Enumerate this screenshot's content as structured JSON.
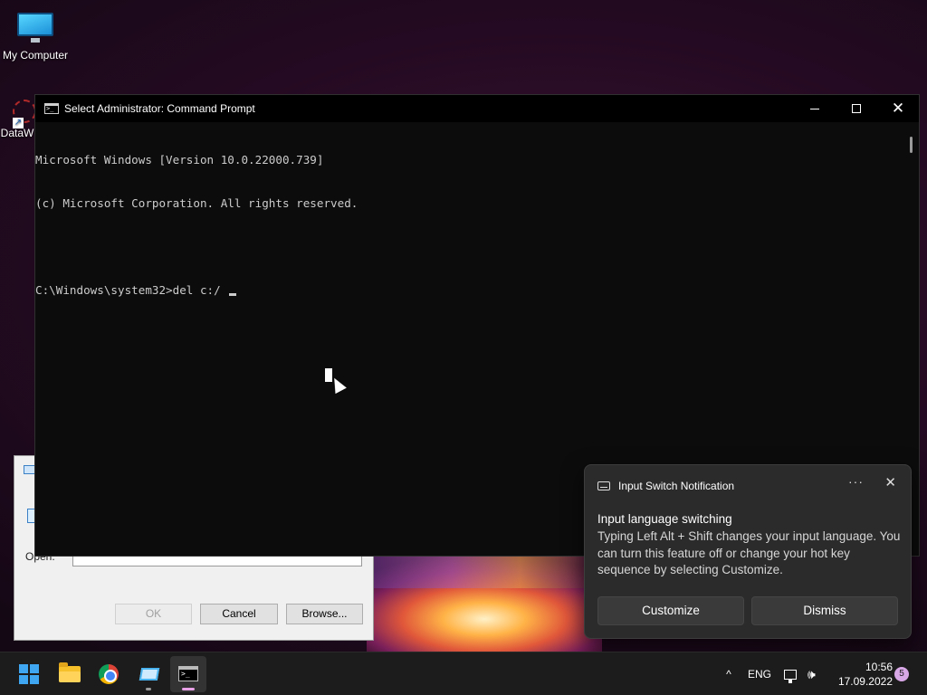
{
  "desktop": {
    "icons": [
      {
        "label": "My Computer"
      },
      {
        "label": "DataW"
      }
    ]
  },
  "run_dialog": {
    "open_label": "Open:",
    "buttons": {
      "ok": "OK",
      "cancel": "Cancel",
      "browse": "Browse..."
    }
  },
  "cmd_window": {
    "title": "Select Administrator: Command Prompt",
    "lines": [
      "Microsoft Windows [Version 10.0.22000.739]",
      "(c) Microsoft Corporation. All rights reserved.",
      "",
      "C:\\Windows\\system32>del c:/ "
    ]
  },
  "notification": {
    "app_name": "Input Switch Notification",
    "more": "···",
    "close": "✕",
    "heading": "Input language switching",
    "body": "Typing Left Alt + Shift changes your input language. You can turn this feature off or change your hot key sequence by selecting Customize.",
    "buttons": {
      "customize": "Customize",
      "dismiss": "Dismiss"
    }
  },
  "taskbar": {
    "apps": [
      {
        "name": "start-button",
        "icon": "windows-logo-icon"
      },
      {
        "name": "file-explorer",
        "icon": "folder-icon"
      },
      {
        "name": "chrome",
        "icon": "chrome-icon"
      },
      {
        "name": "run",
        "icon": "run-window-icon"
      },
      {
        "name": "command-prompt",
        "icon": "terminal-icon",
        "active": true
      }
    ],
    "tray": {
      "chevron": "^",
      "language": "ENG",
      "volume": "🕪",
      "time": "10:56",
      "date": "17.09.2022",
      "notification_count": "5"
    }
  },
  "colors": {
    "accent": "#3fa6f2",
    "active_indicator": "#e8a0e6",
    "cmd_background": "#0c0c0c",
    "cmd_text": "#cccccc"
  }
}
